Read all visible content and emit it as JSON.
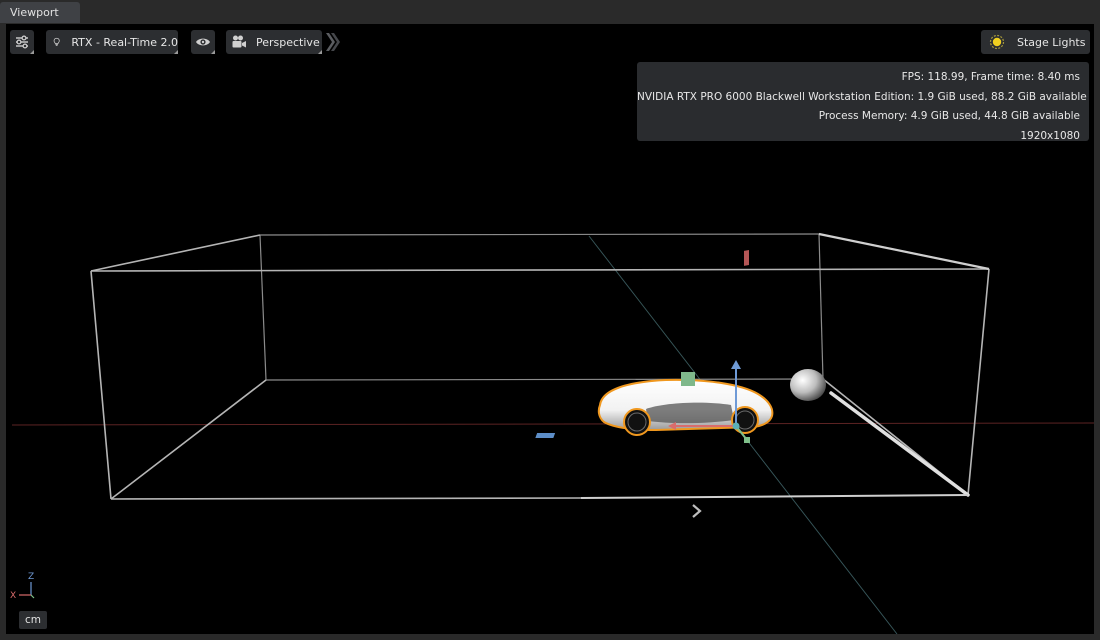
{
  "tab": {
    "label": "Viewport"
  },
  "toolbar": {
    "renderer_label": "RTX - Real-Time 2.0",
    "camera_label": "Perspective",
    "lights_label": "Stage Lights"
  },
  "stats": {
    "fps_line": "FPS: 118.99, Frame time: 8.40 ms",
    "gpu_line": "NVIDIA RTX PRO 6000 Blackwell Workstation Edition: 1.9 GiB used, 88.2 GiB available",
    "memory_line": "Process Memory: 4.9 GiB used, 44.8 GiB available",
    "resolution_line": "1920x1080"
  },
  "axes": {
    "z_label": "Z",
    "x_label": "X"
  },
  "units": {
    "label": "cm"
  },
  "icons": {
    "settings": "sliders-icon",
    "renderer": "lightbulb-icon",
    "visibility": "eye-icon",
    "camera": "movie-camera-icon",
    "lights": "sun-icon",
    "expand": "chevron-right-icon"
  },
  "colors": {
    "selection_outline": "#f0981f",
    "gizmo_x": "#d96c6c",
    "gizmo_y": "#7fc08a",
    "gizmo_z": "#6f9ad6",
    "light_icon": "#f0d020"
  }
}
